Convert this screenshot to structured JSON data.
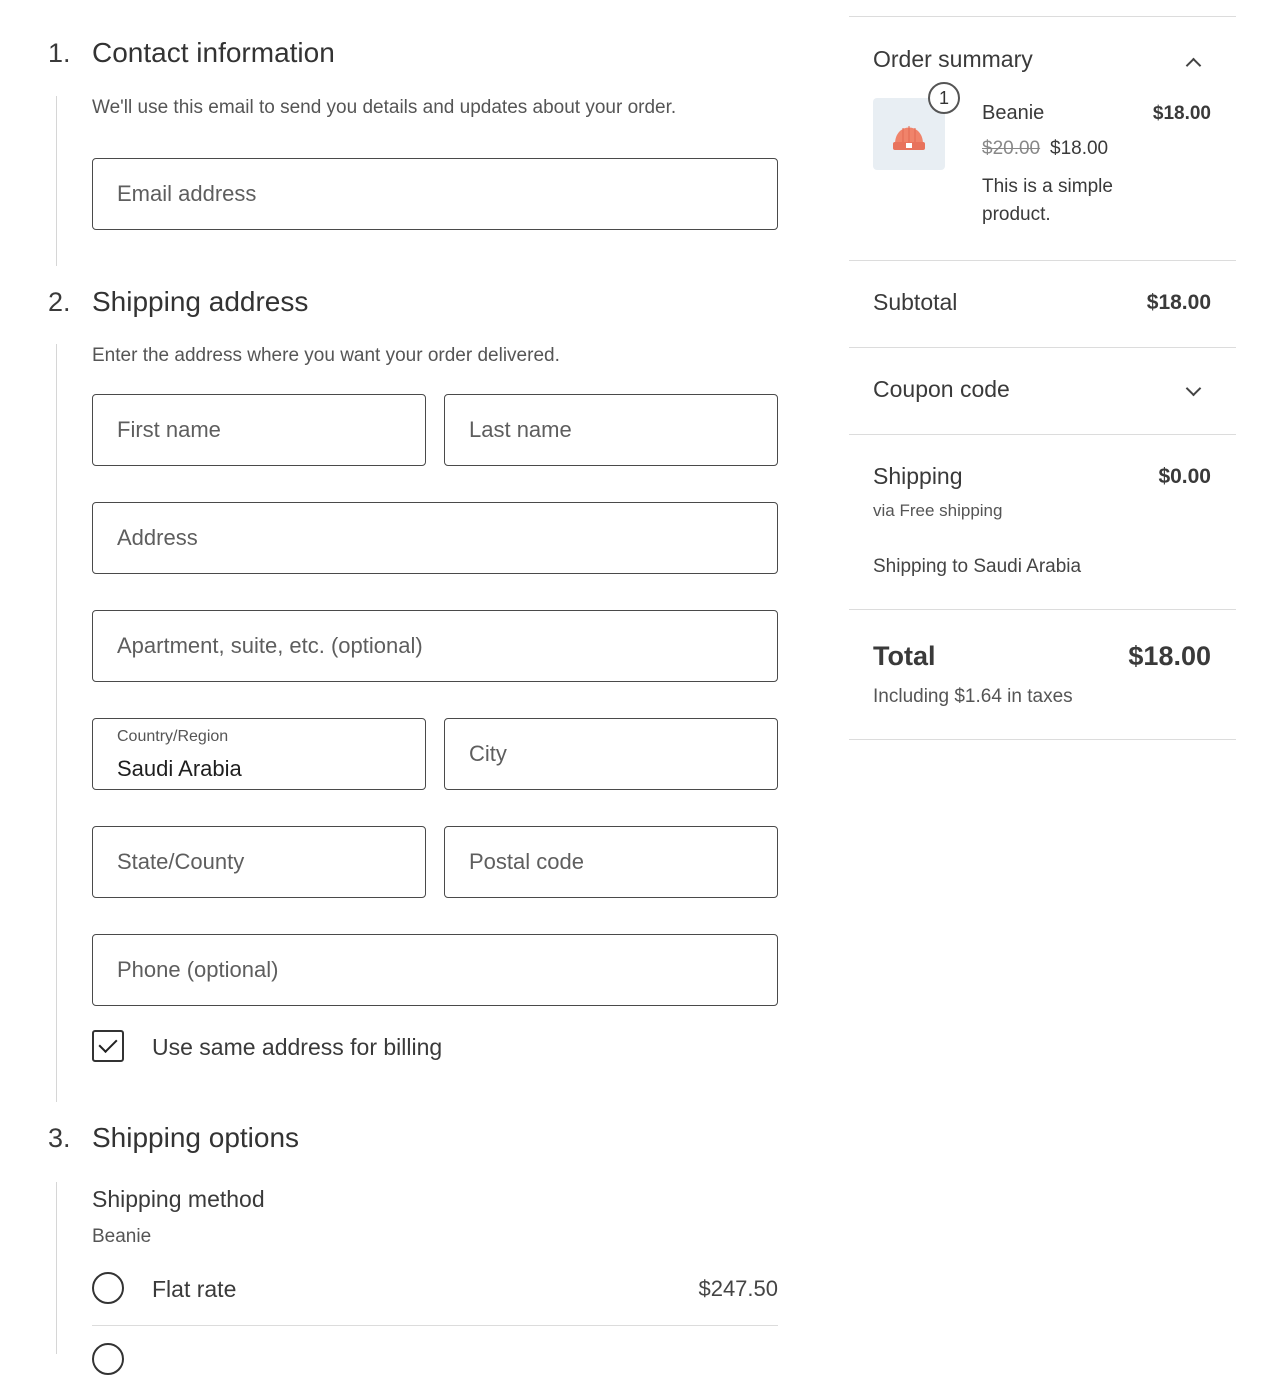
{
  "contact": {
    "step_number": "1.",
    "title": "Contact information",
    "description": "We'll use this email to send you details and updates about your order.",
    "email_placeholder": "Email address"
  },
  "shipping_address": {
    "step_number": "2.",
    "title": "Shipping address",
    "description": "Enter the address where you want your order delivered.",
    "first_name_placeholder": "First name",
    "last_name_placeholder": "Last name",
    "address_placeholder": "Address",
    "apartment_placeholder": "Apartment, suite, etc. (optional)",
    "country_label": "Country/Region",
    "country_value": "Saudi Arabia",
    "city_placeholder": "City",
    "state_placeholder": "State/County",
    "postal_placeholder": "Postal code",
    "phone_placeholder": "Phone (optional)",
    "same_billing_label": "Use same address for billing",
    "same_billing_checked": true
  },
  "shipping_options": {
    "step_number": "3.",
    "title": "Shipping options",
    "method_heading": "Shipping method",
    "package_name": "Beanie",
    "options": [
      {
        "label": "Flat rate",
        "price": "$247.50",
        "selected": false
      }
    ]
  },
  "order_summary": {
    "title": "Order summary",
    "item": {
      "quantity": "1",
      "name": "Beanie",
      "line_total": "$18.00",
      "regular_price": "$20.00",
      "sale_price": "$18.00",
      "description": "This is a simple product.",
      "thumbnail_icon": "beanie-icon"
    },
    "subtotal_label": "Subtotal",
    "subtotal_value": "$18.00",
    "coupon_label": "Coupon code",
    "shipping_label": "Shipping",
    "shipping_value": "$0.00",
    "shipping_method": "via Free shipping",
    "shipping_destination": "Shipping to Saudi Arabia",
    "total_label": "Total",
    "total_value": "$18.00",
    "tax_note": "Including $1.64 in taxes"
  },
  "colors": {
    "border": "#4a4a4a",
    "divider": "#dcdcdc",
    "thumbnail_bg": "#e8eef3",
    "beanie": "#f0836a"
  }
}
